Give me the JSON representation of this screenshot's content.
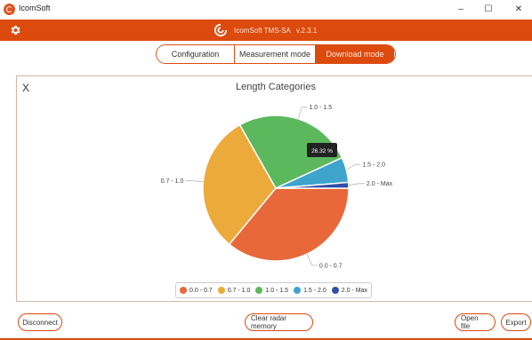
{
  "window": {
    "title": "IcomSoft",
    "minimize": "–",
    "maximize": "☐",
    "close": "✕"
  },
  "appbar": {
    "brand": "IcomSoft TMS-SA",
    "version": "v.2.3.1",
    "color": "#dd4a0e"
  },
  "mode_tabs": [
    {
      "label": "Configuration",
      "active": false
    },
    {
      "label": "Measurement mode",
      "active": false
    },
    {
      "label": "Download mode",
      "active": true
    }
  ],
  "panel": {
    "close_label": "X"
  },
  "chart_data": {
    "type": "pie",
    "title": "Length Categories",
    "slices": [
      {
        "label": "0.0 - 0.7",
        "value": 36.0,
        "color": "#e8683a"
      },
      {
        "label": "0.7 - 1.0",
        "value": 30.8,
        "color": "#ecaa3a"
      },
      {
        "label": "1.0 - 1.5",
        "value": 26.32,
        "color": "#5cb85c"
      },
      {
        "label": "1.5 - 2.0",
        "value": 5.6,
        "color": "#3fa4cc"
      },
      {
        "label": "2.0 - Max",
        "value": 1.28,
        "color": "#2f4fa8"
      }
    ],
    "tooltip": "26.32 %",
    "legend_position": "bottom"
  },
  "buttons": {
    "disconnect": "Disconnect",
    "clear_radar": "Clear radar memory",
    "open_file": "Open file",
    "export": "Export"
  }
}
